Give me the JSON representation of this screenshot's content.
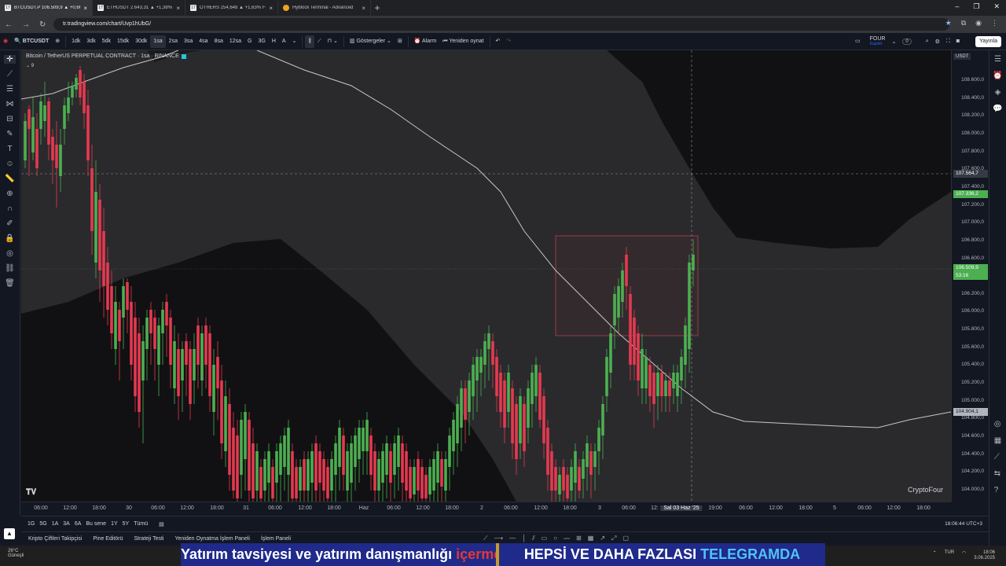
{
  "browser": {
    "tabs": [
      {
        "label": "BTCUSDT.P 106.509,9 ▲ +0,66%",
        "active": true
      },
      {
        "label": "ETHUSDT 2.643,31 ▲ +1,38% E",
        "active": false
      },
      {
        "label": "OTHERS 254,648 ▲ +1,63% FO",
        "active": false
      },
      {
        "label": "Hyblock Terminal - Advanced",
        "active": false
      }
    ],
    "url": "tr.tradingview.com/chart/Uvp1hUbG/"
  },
  "toolbar": {
    "symbol": "BTCUSDT",
    "intervals": [
      "1dk",
      "3dk",
      "5dk",
      "15dk",
      "30dk",
      "1sa",
      "2sa",
      "3sa",
      "4sa",
      "8sa",
      "12sa",
      "G",
      "3G",
      "H",
      "A"
    ],
    "selected_interval": "1sa",
    "indicators_label": "Göstergeler",
    "alarm_label": "Alarm",
    "replay_label": "Yeniden oynat",
    "layout_name": "FOUR",
    "layout_sub": "Kaydet",
    "layout_badge": "0",
    "publish_label": "Yayınla",
    "notification_badge": "11"
  },
  "legend": {
    "title": "Bitcoin / TetherUS PERPETUAL CONTRACT · 1sa · BINANCE",
    "indicator_count": "9"
  },
  "price_axis": {
    "currency": "USDT",
    "ticks": [
      "108.600,0",
      "108.400,0",
      "108.200,0",
      "108.000,0",
      "107.800,0",
      "107.600,0",
      "107.400,0",
      "107.200,0",
      "107.000,0",
      "106.800,0",
      "106.600,0",
      "106.400,0",
      "106.200,0",
      "106.000,0",
      "105.800,0",
      "105.600,0",
      "105.400,0",
      "105.200,0",
      "105.000,0",
      "104.800,0",
      "104.600,0",
      "104.400,0",
      "104.200,0",
      "104.000,0"
    ],
    "crosshair_price": "107.564,7",
    "green_label": "107.336,2",
    "last_price": "106.509,9",
    "countdown": "53:16",
    "ma_label": "104.904,1"
  },
  "time_axis": {
    "labels": [
      "06:00",
      "12:00",
      "18:00",
      "30",
      "06:00",
      "12:00",
      "18:00",
      "31",
      "06:00",
      "12:00",
      "18:00",
      "Haz",
      "06:00",
      "12:00",
      "18:00",
      "2",
      "06:00",
      "12:00",
      "18:00",
      "3",
      "06:00",
      "12:",
      "Sal 03 Haz '25",
      "19:00",
      "06:00",
      "12:00",
      "18:00",
      "5",
      "06:00",
      "12:00",
      "18:00"
    ],
    "highlighted": "Sal 03 Haz '25"
  },
  "range_bar": {
    "ranges": [
      "1G",
      "5G",
      "1A",
      "3A",
      "6A",
      "Bu sene",
      "1Y",
      "5Y",
      "Tümü"
    ],
    "clock": "18:06:44 UTC+3"
  },
  "bottom_tabs": [
    "Kripto Çiftleri Takipçisi",
    "Pine Editörü",
    "Strateji Testi",
    "Yeniden Oynatma İşlem Paneli",
    "İşlem Paneli"
  ],
  "watermark": "CryptoFour",
  "taskbar": {
    "weather_temp": "26°C",
    "weather_desc": "Güneşli",
    "lang": "TUR",
    "time": "18:06",
    "date": "3.06.2025"
  },
  "banner": {
    "left_main": "Yatırım tavsiyesi ve yatırım danışmanlığı ",
    "left_warn": "içermez",
    "right_main": "HEPSİ VE DAHA FAZLASI ",
    "right_accent": "TELEGRAMDA"
  },
  "colors": {
    "up": "#4caf50",
    "down": "#e53950",
    "last_price_bg": "#4caf50",
    "banner_bg": "#1f2a8a"
  }
}
